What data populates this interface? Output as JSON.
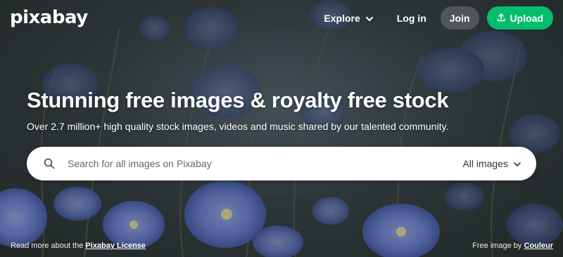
{
  "brand": {
    "logo_text": "pixabay"
  },
  "nav": {
    "explore_label": "Explore",
    "login_label": "Log in",
    "join_label": "Join",
    "upload_label": "Upload"
  },
  "hero": {
    "headline": "Stunning free images & royalty free stock",
    "subline": "Over 2.7 million+ high quality stock images, videos and music shared by our talented community."
  },
  "search": {
    "placeholder": "Search for all images on Pixabay",
    "filter_label": "All images"
  },
  "footer": {
    "license_prefix": "Read more about the",
    "license_link": "Pixabay License",
    "credit_prefix": "Free image by",
    "credit_link": "Couleur"
  },
  "colors": {
    "accent_green": "#02be6e",
    "flower_blue": "#6f86d8"
  },
  "icons": {
    "explore": "chevron-down-icon",
    "upload": "upload-icon",
    "search": "search-icon",
    "filter": "chevron-down-icon"
  }
}
